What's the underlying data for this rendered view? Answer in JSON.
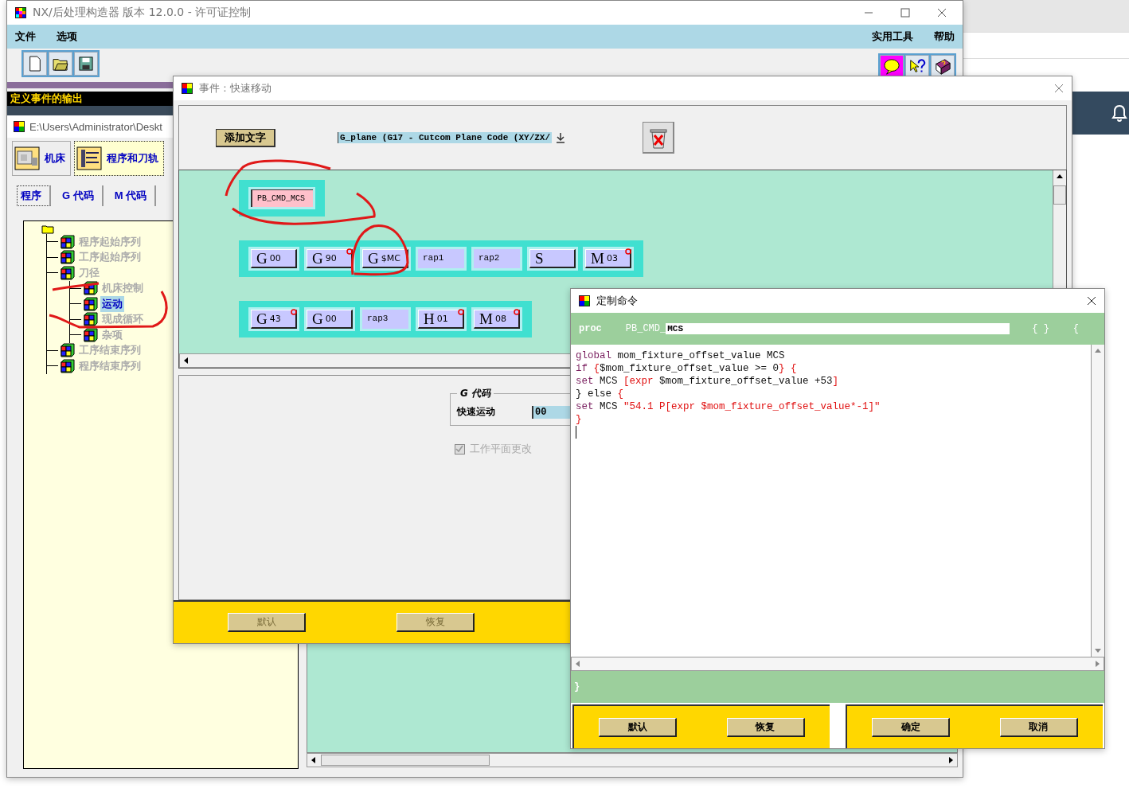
{
  "main_window": {
    "title": "NX/后处理构造器 版本 12.0.0 - 许可证控制",
    "menu_left": [
      "文件",
      "选项"
    ],
    "menu_right": [
      "实用工具",
      "帮助"
    ],
    "banner": "定义事件的输出",
    "sub_title": "E:\\Users\\Administrator\\Deskt",
    "tabs": [
      {
        "label": "机床",
        "kind": "machine",
        "selected": false
      },
      {
        "label": "程序和刀轨",
        "kind": "toolpath",
        "selected": true
      }
    ],
    "subtabs": [
      {
        "label": "程序",
        "selected": true
      },
      {
        "label": "G 代码",
        "selected": false
      },
      {
        "label": "M 代码",
        "selected": false
      }
    ],
    "tree": [
      {
        "label": "程序起始序列",
        "selected": false
      },
      {
        "label": "工序起始序列",
        "selected": false
      },
      {
        "label": "刀径",
        "selected": false,
        "children": [
          {
            "label": "机床控制",
            "selected": false
          },
          {
            "label": "运动",
            "selected": true
          },
          {
            "label": "现成循环",
            "selected": false
          },
          {
            "label": "杂项",
            "selected": false
          }
        ]
      },
      {
        "label": "工序结束序列",
        "selected": false
      },
      {
        "label": "程序结束序列",
        "selected": false
      }
    ]
  },
  "event_dialog": {
    "title": "事件 : 快速移动",
    "add_text_button": "添加文字",
    "address_dropdown": "G_plane (G17 - Cutcom Plane Code (XY/ZX/",
    "rows": [
      [
        {
          "kind": "command",
          "text": "PB_CMD_MCS"
        }
      ],
      [
        {
          "kind": "address",
          "letter": "G",
          "value": "00",
          "flagged": false
        },
        {
          "kind": "address",
          "letter": "G",
          "value": "90",
          "flagged": true
        },
        {
          "kind": "address",
          "letter": "G",
          "value": "$MC",
          "flagged": false
        },
        {
          "kind": "text",
          "text": "rap1"
        },
        {
          "kind": "text",
          "text": "rap2"
        },
        {
          "kind": "address",
          "letter": "S",
          "flagged": false
        },
        {
          "kind": "address",
          "letter": "M",
          "value": "03",
          "flagged": true
        }
      ],
      [
        {
          "kind": "address",
          "letter": "G",
          "value": "43",
          "flagged": true
        },
        {
          "kind": "address",
          "letter": "G",
          "value": "00",
          "flagged": false
        },
        {
          "kind": "text",
          "text": "rap3"
        },
        {
          "kind": "address",
          "letter": "H",
          "value": "01",
          "flagged": true
        },
        {
          "kind": "address",
          "letter": "M",
          "value": "08",
          "flagged": true
        }
      ]
    ],
    "group_title": "G 代码",
    "field_label": "快速运动",
    "field_value": "00",
    "checkbox": {
      "label": "工作平面更改",
      "checked": true,
      "disabled": true
    },
    "buttons": [
      {
        "label": "默认",
        "disabled": true
      },
      {
        "label": "恢复",
        "disabled": true
      }
    ]
  },
  "custom_dialog": {
    "title": "定制命令",
    "proc_keyword": "proc",
    "name_prefix": "PB_CMD_",
    "name_value": "MCS",
    "args": "{ }",
    "open_brace": "{",
    "code_lines": [
      [
        {
          "kind": "keyword",
          "text": "global"
        },
        {
          "kind": "plain",
          "text": " mom_fixture_offset_value MCS"
        }
      ],
      [
        {
          "kind": "keyword",
          "text": "if"
        },
        {
          "kind": "brace",
          "text": " {"
        },
        {
          "kind": "plain",
          "text": "$mom_fixture_offset_value >= 0"
        },
        {
          "kind": "brace",
          "text": "} {"
        }
      ],
      [
        {
          "kind": "keyword",
          "text": "set"
        },
        {
          "kind": "plain",
          "text": " MCS "
        },
        {
          "kind": "brace",
          "text": "[expr"
        },
        {
          "kind": "plain",
          "text": " $mom_fixture_offset_value +53"
        },
        {
          "kind": "brace",
          "text": "]"
        }
      ],
      [
        {
          "kind": "plain",
          "text": "} else "
        },
        {
          "kind": "brace",
          "text": "{"
        }
      ],
      [
        {
          "kind": "keyword",
          "text": "set"
        },
        {
          "kind": "plain",
          "text": " MCS "
        },
        {
          "kind": "string",
          "text": "\"54.1 P[expr $mom_fixture_offset_value*-1]\""
        }
      ],
      [
        {
          "kind": "brace",
          "text": "}"
        }
      ]
    ],
    "close_brace": "}",
    "button_groups": [
      [
        {
          "label": "默认",
          "disabled": false
        },
        {
          "label": "恢复",
          "disabled": false
        }
      ],
      [
        {
          "label": "确定",
          "disabled": false
        },
        {
          "label": "取消",
          "disabled": false
        }
      ]
    ]
  }
}
